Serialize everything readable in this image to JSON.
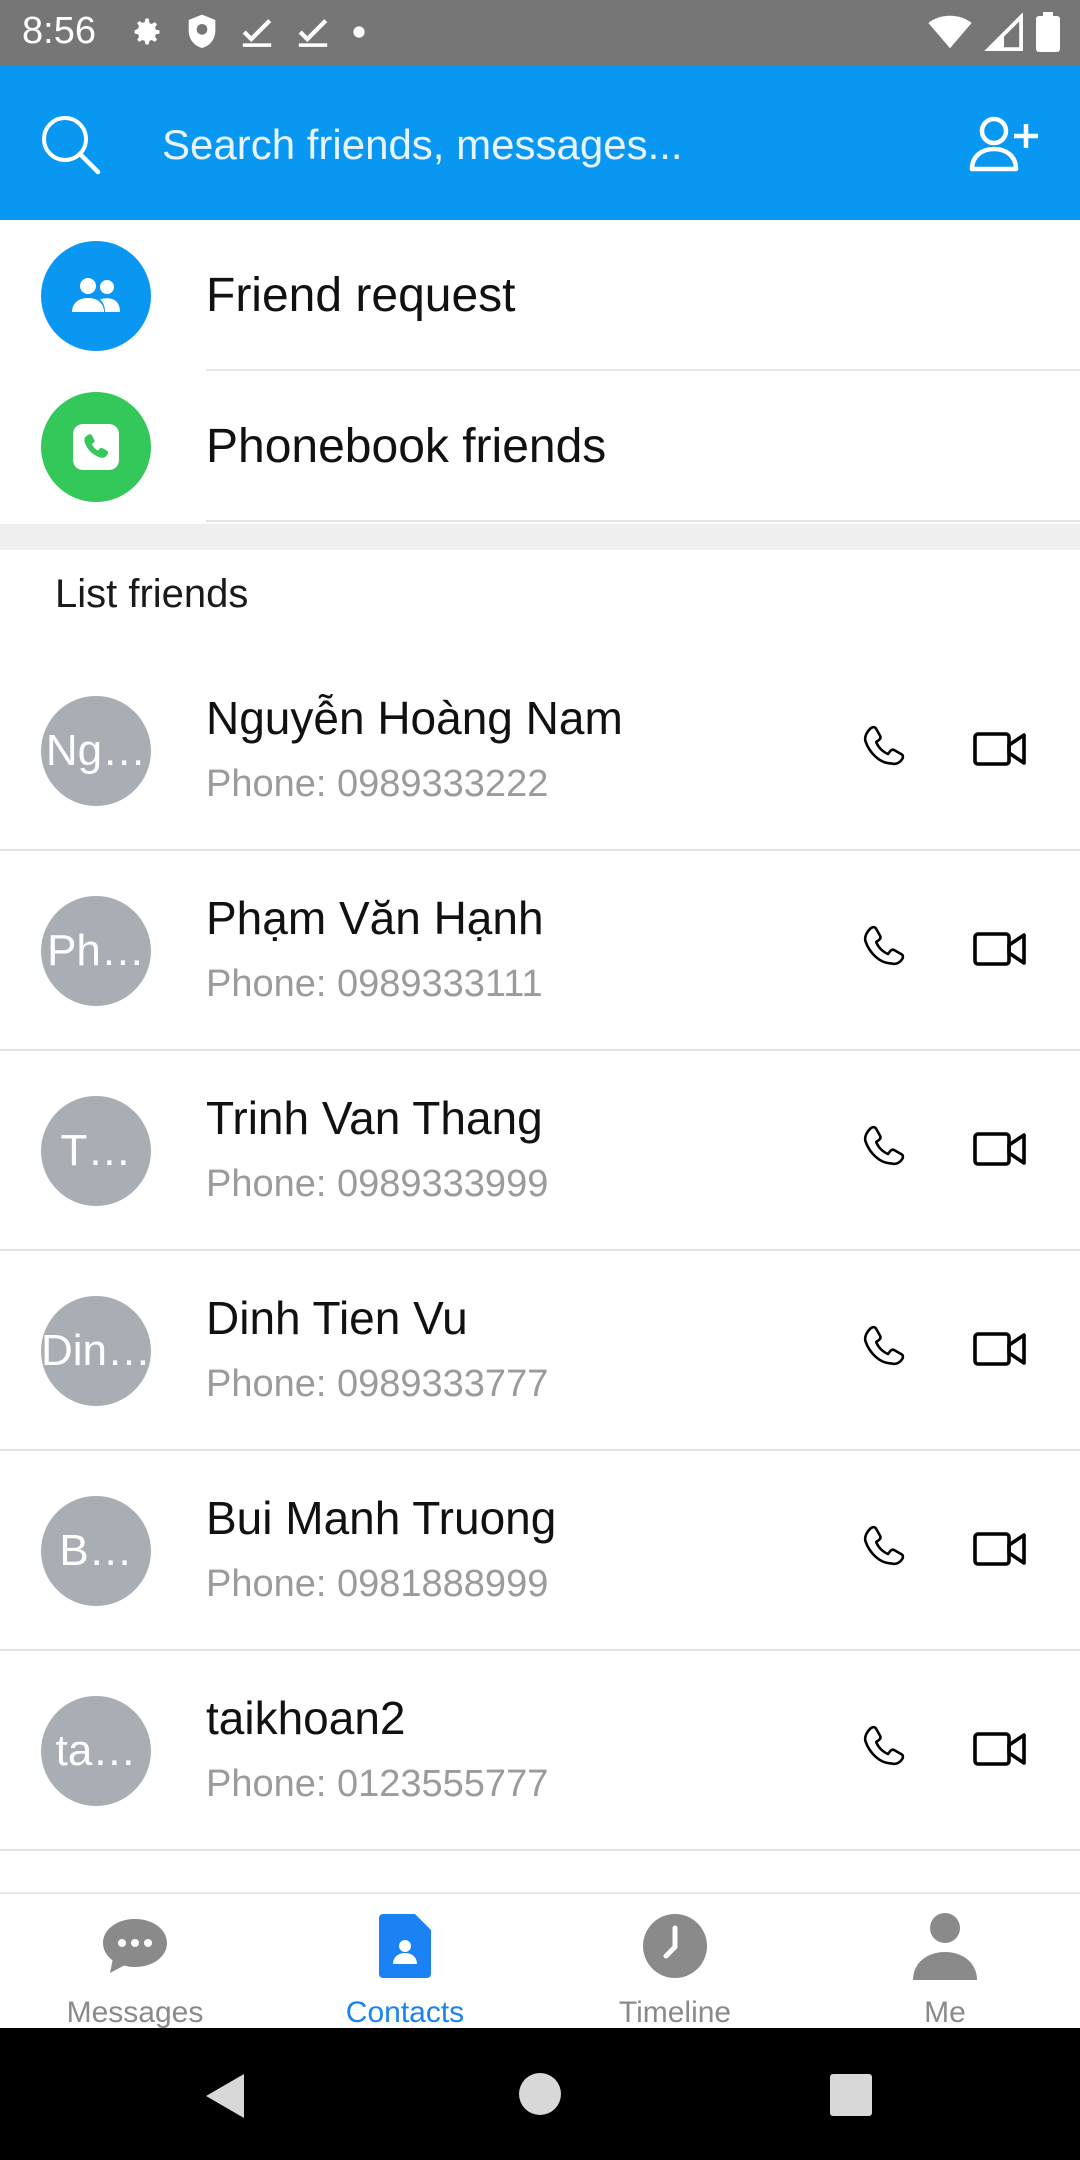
{
  "status_bar": {
    "time": "8:56"
  },
  "search": {
    "placeholder": "Search friends, messages..."
  },
  "shortcuts": [
    {
      "label": "Friend request",
      "color": "#0a97f2",
      "icon": "people-icon"
    },
    {
      "label": "Phonebook friends",
      "color": "#34c759",
      "icon": "phone-book-icon"
    }
  ],
  "section": {
    "title": "List friends"
  },
  "friends": [
    {
      "initials": "Ng…",
      "name": "Nguyễn Hoàng Nam",
      "phone": "Phone: 0989333222"
    },
    {
      "initials": "Ph…",
      "name": "Phạm Văn Hạnh",
      "phone": "Phone: 0989333111"
    },
    {
      "initials": "T…",
      "name": "Trinh Van Thang",
      "phone": "Phone: 0989333999"
    },
    {
      "initials": "Din…",
      "name": "Dinh Tien Vu",
      "phone": "Phone: 0989333777"
    },
    {
      "initials": "B…",
      "name": "Bui Manh Truong",
      "phone": "Phone: 0981888999"
    },
    {
      "initials": "ta…",
      "name": "taikhoan2",
      "phone": "Phone: 0123555777"
    }
  ],
  "bottom_nav": {
    "messages": "Messages",
    "contacts": "Contacts",
    "timeline": "Timeline",
    "me": "Me"
  },
  "colors": {
    "accent": "#0897f1",
    "active_tab": "#1a82f2",
    "avatar_bg": "#a9adb4"
  }
}
